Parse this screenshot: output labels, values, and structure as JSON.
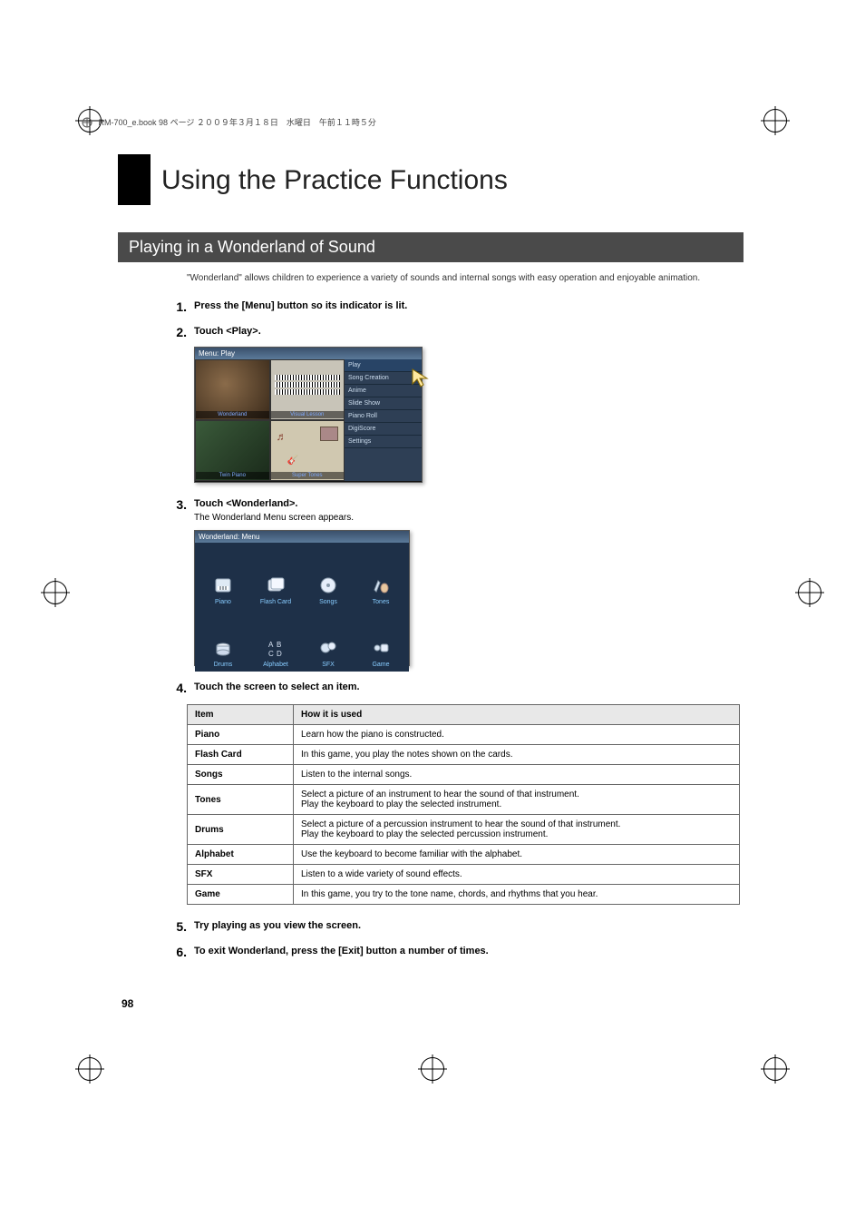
{
  "header_line": "RM-700_e.book  98 ページ  ２００９年３月１８日　水曜日　午前１１時５分",
  "title": "Using the Practice Functions",
  "section": "Playing in a Wonderland of Sound",
  "intro": "\"Wonderland\" allows children to experience a variety of sounds and internal songs with easy operation and enjoyable animation.",
  "steps": {
    "s1": {
      "num": "1.",
      "title": "Press the [Menu] button so its indicator is lit."
    },
    "s2": {
      "num": "2.",
      "title": "Touch <Play>."
    },
    "s3": {
      "num": "3.",
      "title": "Touch <Wonderland>.",
      "sub": "The Wonderland Menu screen appears."
    },
    "s4": {
      "num": "4.",
      "title": "Touch the screen to select an item."
    },
    "s5": {
      "num": "5.",
      "title": "Try playing as you view the screen."
    },
    "s6": {
      "num": "6.",
      "title": "To exit Wonderland, press the [Exit] button a number of times."
    }
  },
  "play_screen": {
    "title": "Menu: Play",
    "cells": [
      "Wonderland",
      "Visual Lesson",
      "Twin Piano",
      "Super Tones"
    ],
    "sidebar": [
      "Play",
      "Song Creation",
      "Anime",
      "Slide Show",
      "Piano Roll",
      "DigiScore",
      "Settings"
    ]
  },
  "wonder_screen": {
    "title": "Wonderland: Menu",
    "items": [
      "Piano",
      "Flash Card",
      "Songs",
      "Tones",
      "Drums",
      "Alphabet",
      "SFX",
      "Game"
    ]
  },
  "table": {
    "head_item": "Item",
    "head_how": "How it is used",
    "rows": [
      {
        "item": "Piano",
        "how": "Learn how the piano is constructed."
      },
      {
        "item": "Flash Card",
        "how": "In this game, you play the notes shown on the cards."
      },
      {
        "item": "Songs",
        "how": "Listen to the internal songs."
      },
      {
        "item": "Tones",
        "how": "Select a picture of an instrument to hear the sound of that instrument.\nPlay the keyboard to play the selected instrument."
      },
      {
        "item": "Drums",
        "how": "Select a picture of a percussion instrument to hear the sound of that instrument.\nPlay the keyboard to play the selected percussion instrument."
      },
      {
        "item": "Alphabet",
        "how": "Use the keyboard to become familiar with the alphabet."
      },
      {
        "item": "SFX",
        "how": "Listen to a wide variety of sound effects."
      },
      {
        "item": "Game",
        "how": "In this game, you try to the tone name, chords, and rhythms that you hear."
      }
    ]
  },
  "page_number": "98"
}
